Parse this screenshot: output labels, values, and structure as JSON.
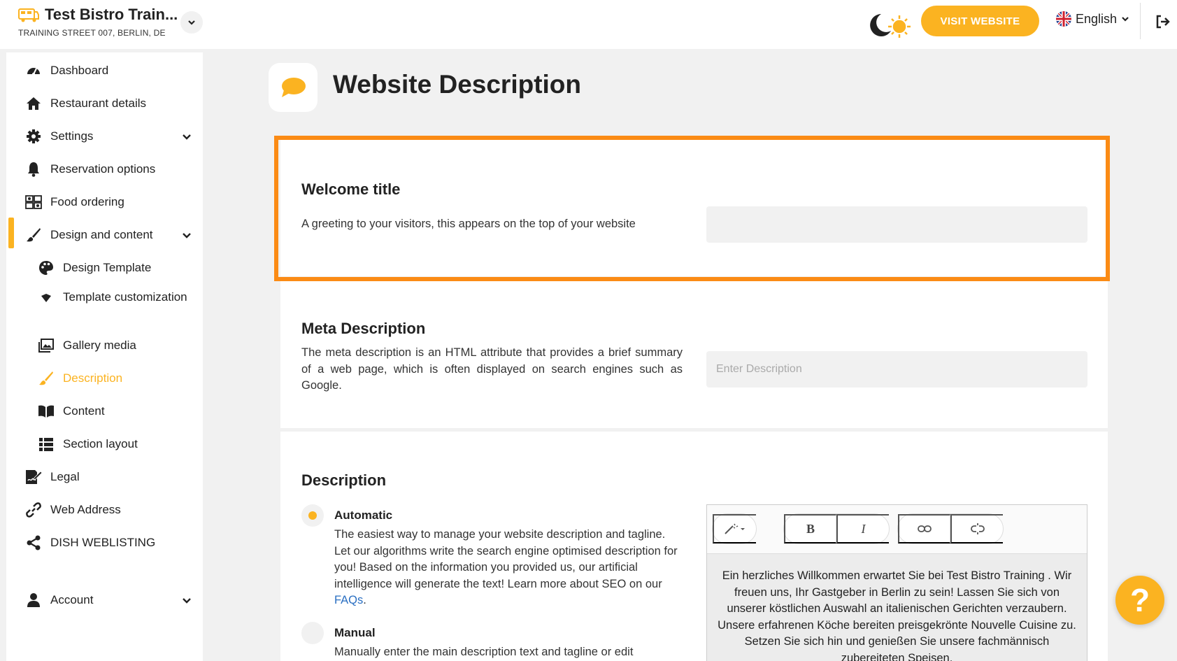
{
  "header": {
    "restaurant_name": "Test Bistro Train...",
    "address": "TRAINING STREET 007, BERLIN, DE",
    "visit_website": "VISIT WEBSITE",
    "language": "English"
  },
  "sidebar": {
    "items": [
      {
        "label": "Dashboard",
        "icon": "dashboard-icon"
      },
      {
        "label": "Restaurant details",
        "icon": "home-icon"
      },
      {
        "label": "Settings",
        "icon": "gear-icon"
      },
      {
        "label": "Reservation options",
        "icon": "bell-icon"
      },
      {
        "label": "Food ordering",
        "icon": "food-ordering-icon"
      },
      {
        "label": "Design and content",
        "icon": "brush-icon"
      },
      {
        "label": "Design Template",
        "icon": "palette-icon"
      },
      {
        "label": "Template customization",
        "icon": "spray-icon"
      },
      {
        "label": "Gallery media",
        "icon": "images-icon"
      },
      {
        "label": "Description",
        "icon": "pencil-icon"
      },
      {
        "label": "Content",
        "icon": "book-icon"
      },
      {
        "label": "Section layout",
        "icon": "list-icon"
      },
      {
        "label": "Legal",
        "icon": "signature-icon"
      },
      {
        "label": "Web Address",
        "icon": "link-icon"
      },
      {
        "label": "DISH WEBLISTING",
        "icon": "share-icon"
      },
      {
        "label": "Account",
        "icon": "user-icon"
      }
    ]
  },
  "main": {
    "title": "Website Description",
    "welcome": {
      "title": "Welcome title",
      "desc": "A greeting to your visitors, this appears on the top of your website",
      "value": ""
    },
    "meta": {
      "title": "Meta Description",
      "desc": "The meta description is an HTML attribute that provides a brief summary of a web page, which is often displayed on search engines such as Google.",
      "placeholder": "Enter Description"
    },
    "description": {
      "title": "Description",
      "automatic_title": "Automatic",
      "automatic_desc": "The easiest way to manage your website description and tagline. Let our algorithms write the search engine optimised description for you! Based on the information you provided us, our artificial intelligence will generate the text! Learn more about SEO on our ",
      "faq_link": "FAQs",
      "automatic_desc_end": ".",
      "manual_title": "Manual",
      "manual_desc": "Manually enter the main description text and tagline or edit",
      "editor_text": "Ein herzliches Willkommen erwartet Sie bei Test Bistro Training . Wir freuen uns, Ihr Gastgeber in Berlin zu sein! Lassen Sie sich von unserer köstlichen Auswahl an italienischen Gerichten verzaubern. Unsere erfahrenen Köche bereiten preisgekrönte Nouvelle Cuisine zu. Setzen Sie sich hin und genießen Sie unsere fachmännisch zubereiteten Speisen."
    },
    "toolbar": {
      "bold": "B",
      "italic": "I"
    }
  },
  "help": "?",
  "colors": {
    "accent": "#fbb321",
    "highlight": "#fb8b15",
    "link": "#2a6fc2"
  }
}
